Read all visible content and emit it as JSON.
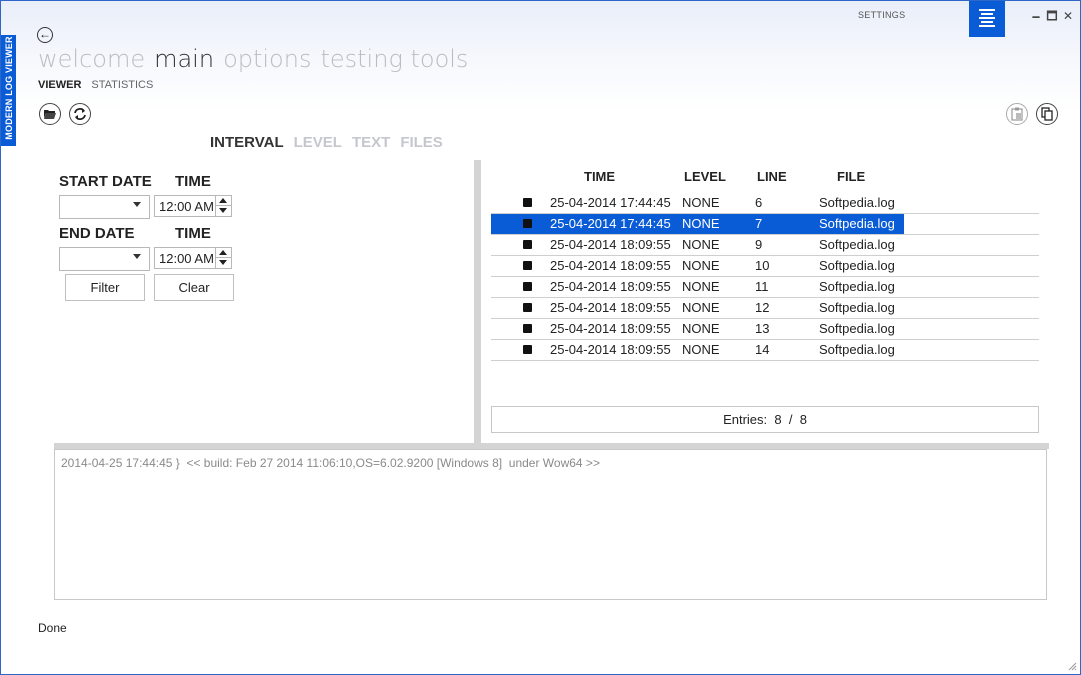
{
  "app": {
    "side_title": "MODERN LOG VIEWER",
    "settings_label": "SETTINGS",
    "window_controls": {
      "minimize": "🗕",
      "maximize": "🗖",
      "close": "✕"
    },
    "accent_color": "#0a5bd6"
  },
  "nav": {
    "back_icon": "←",
    "sections": [
      {
        "label": "welcome",
        "active": false
      },
      {
        "label": "main",
        "active": true
      },
      {
        "label": "options",
        "active": false
      },
      {
        "label": "testing tools",
        "active": false
      }
    ],
    "subsections": [
      {
        "label": "VIEWER",
        "active": true
      },
      {
        "label": "STATISTICS",
        "active": false
      }
    ]
  },
  "toolbar": {
    "left_icons": [
      "open-folder-icon",
      "refresh-icon"
    ],
    "right_icons": [
      "paste-icon",
      "copy-icon"
    ]
  },
  "filter_tabs": [
    {
      "label": "INTERVAL",
      "active": true
    },
    {
      "label": "LEVEL",
      "active": false
    },
    {
      "label": "TEXT",
      "active": false
    },
    {
      "label": "FILES",
      "active": false
    }
  ],
  "interval": {
    "start_date_label": "START DATE",
    "start_time_label": "TIME",
    "start_date_value": "",
    "start_time_value": "12:00 AM",
    "end_date_label": "END DATE",
    "end_time_label": "TIME",
    "end_date_value": "",
    "end_time_value": "12:00 AM",
    "filter_button": "Filter",
    "clear_button": "Clear"
  },
  "grid": {
    "columns": {
      "time": "TIME",
      "level": "LEVEL",
      "line": "LINE",
      "file": "FILE"
    },
    "rows": [
      {
        "time": "25-04-2014 17:44:45",
        "level": "NONE",
        "line": "6",
        "file": "Softpedia.log",
        "selected": false
      },
      {
        "time": "25-04-2014 17:44:45",
        "level": "NONE",
        "line": "7",
        "file": "Softpedia.log",
        "selected": true
      },
      {
        "time": "25-04-2014 18:09:55",
        "level": "NONE",
        "line": "9",
        "file": "Softpedia.log",
        "selected": false
      },
      {
        "time": "25-04-2014 18:09:55",
        "level": "NONE",
        "line": "10",
        "file": "Softpedia.log",
        "selected": false
      },
      {
        "time": "25-04-2014 18:09:55",
        "level": "NONE",
        "line": "11",
        "file": "Softpedia.log",
        "selected": false
      },
      {
        "time": "25-04-2014 18:09:55",
        "level": "NONE",
        "line": "12",
        "file": "Softpedia.log",
        "selected": false
      },
      {
        "time": "25-04-2014 18:09:55",
        "level": "NONE",
        "line": "13",
        "file": "Softpedia.log",
        "selected": false
      },
      {
        "time": "25-04-2014 18:09:55",
        "level": "NONE",
        "line": "14",
        "file": "Softpedia.log",
        "selected": false
      }
    ],
    "entries_label": "Entries:",
    "entries_shown": "8",
    "entries_sep": "/",
    "entries_total": "8"
  },
  "detail": {
    "text": "2014-04-25 17:44:45 }  << build: Feb 27 2014 11:06:10,OS=6.02.9200 [Windows 8]  under Wow64 >>"
  },
  "status": {
    "text": "Done"
  }
}
